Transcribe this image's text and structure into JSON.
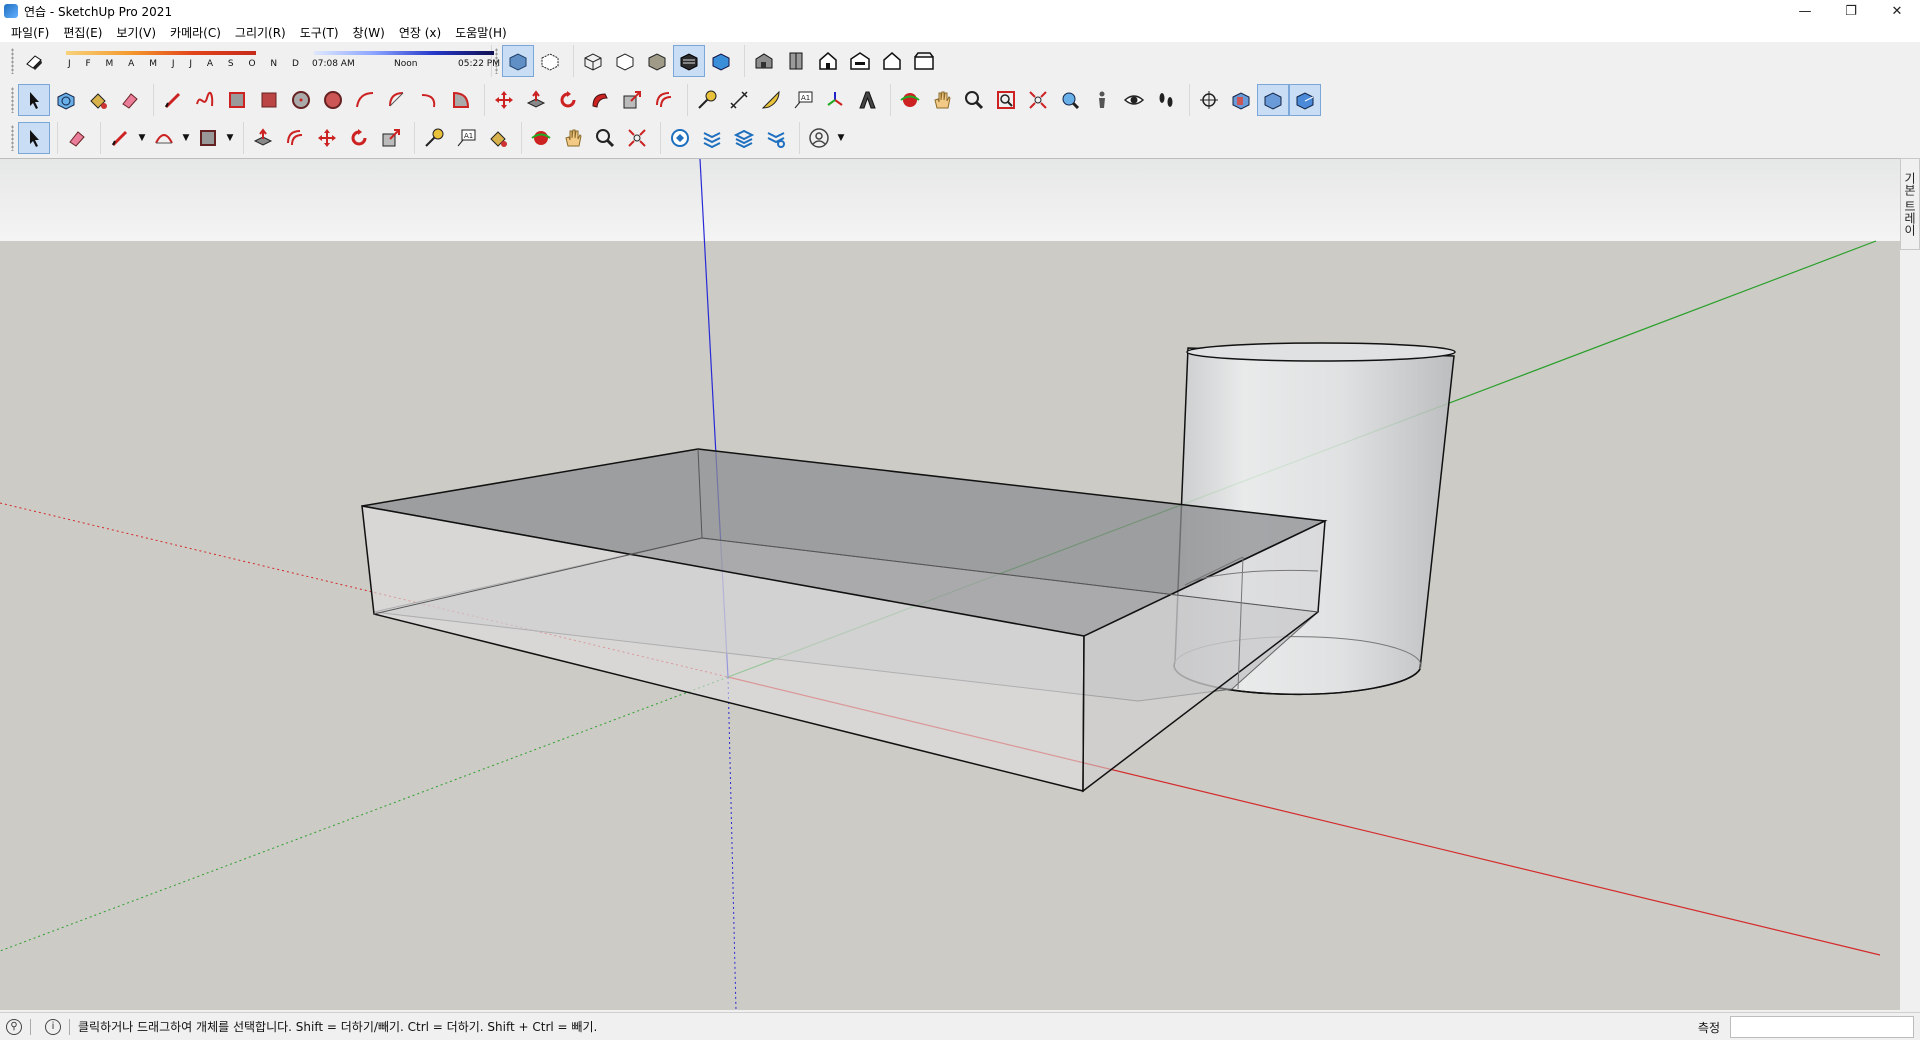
{
  "window": {
    "title": "연습 - SketchUp Pro 2021",
    "controls": {
      "minimize": "—",
      "restore": "❐",
      "close": "✕"
    }
  },
  "menu": [
    "파일(F)",
    "편집(E)",
    "보기(V)",
    "카메라(C)",
    "그리기(R)",
    "도구(T)",
    "창(W)",
    "연장 (x)",
    "도움말(H)"
  ],
  "shadow_settings": {
    "months": "J F M A M J J A S O N D",
    "time_start": "07:08 AM",
    "time_mid": "Noon",
    "time_end": "05:22 PM"
  },
  "toolbar_rows": {
    "row1_views": [
      "iso-view-icon",
      "top-view-icon",
      "front-view-icon",
      "right-view-icon",
      "back-view-icon",
      "left-view-icon"
    ],
    "row1_styles": [
      "xray-icon",
      "back-edges-icon",
      "wireframe-icon",
      "hidden-line-icon",
      "shaded-icon",
      "textured-icon",
      "monochrome-icon"
    ]
  },
  "tray": {
    "tab_label": "기본 트레이"
  },
  "status": {
    "hint": "클릭하거나 드래그하여 개체를 선택합니다. Shift = 더하기/빼기. Ctrl = 더하기. Shift + Ctrl = 빼기.",
    "measure_label": "측정",
    "measure_value": ""
  },
  "colors": {
    "viewport_bg": "#cccbc6",
    "sky": "#e8e9e9",
    "axis_red": "#d42b2b",
    "axis_green": "#2ca02c",
    "axis_blue": "#2a2ad6",
    "active_tool": "#c9def5"
  }
}
